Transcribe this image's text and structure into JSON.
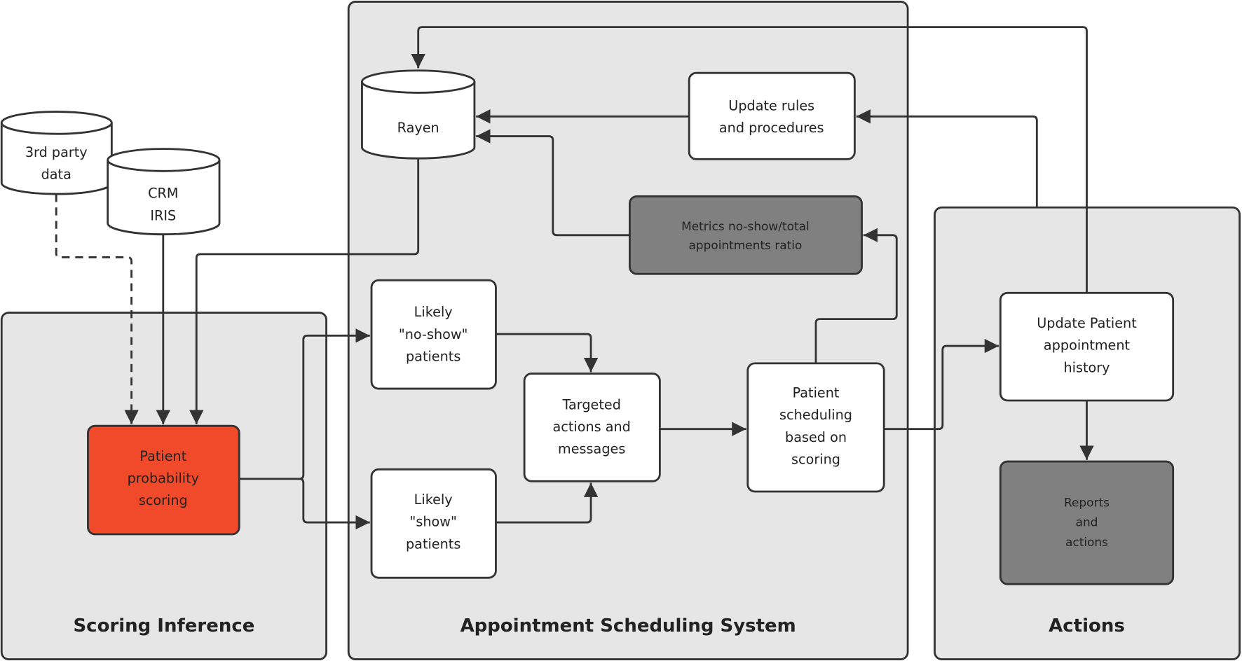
{
  "groups": {
    "scoring": "Scoring Inference",
    "scheduling": "Appointment Scheduling System",
    "actions": "Actions"
  },
  "nodes": {
    "third_party": [
      "3rd party",
      "data"
    ],
    "crm": [
      "CRM",
      "IRIS"
    ],
    "rayen": "Rayen",
    "update_rules": [
      "Update rules",
      "and procedures"
    ],
    "metrics": [
      "Metrics no-show/total",
      "appointments ratio"
    ],
    "no_show": [
      "Likely",
      "\"no-show\"",
      "patients"
    ],
    "show": [
      "Likely",
      "\"show\"",
      "patients"
    ],
    "targeted": [
      "Targeted",
      "actions and",
      "messages"
    ],
    "patient_scheduling": [
      "Patient",
      "scheduling",
      "based on",
      "scoring"
    ],
    "update_history": [
      "Update Patient",
      "appointment",
      "history"
    ],
    "reports": [
      "Reports",
      "and",
      "actions"
    ],
    "probability": [
      "Patient",
      "probability",
      "scoring"
    ]
  },
  "colors": {
    "group_fill": "#e6e6e6",
    "highlight": "#f04a2a",
    "dark_node": "#808080"
  }
}
